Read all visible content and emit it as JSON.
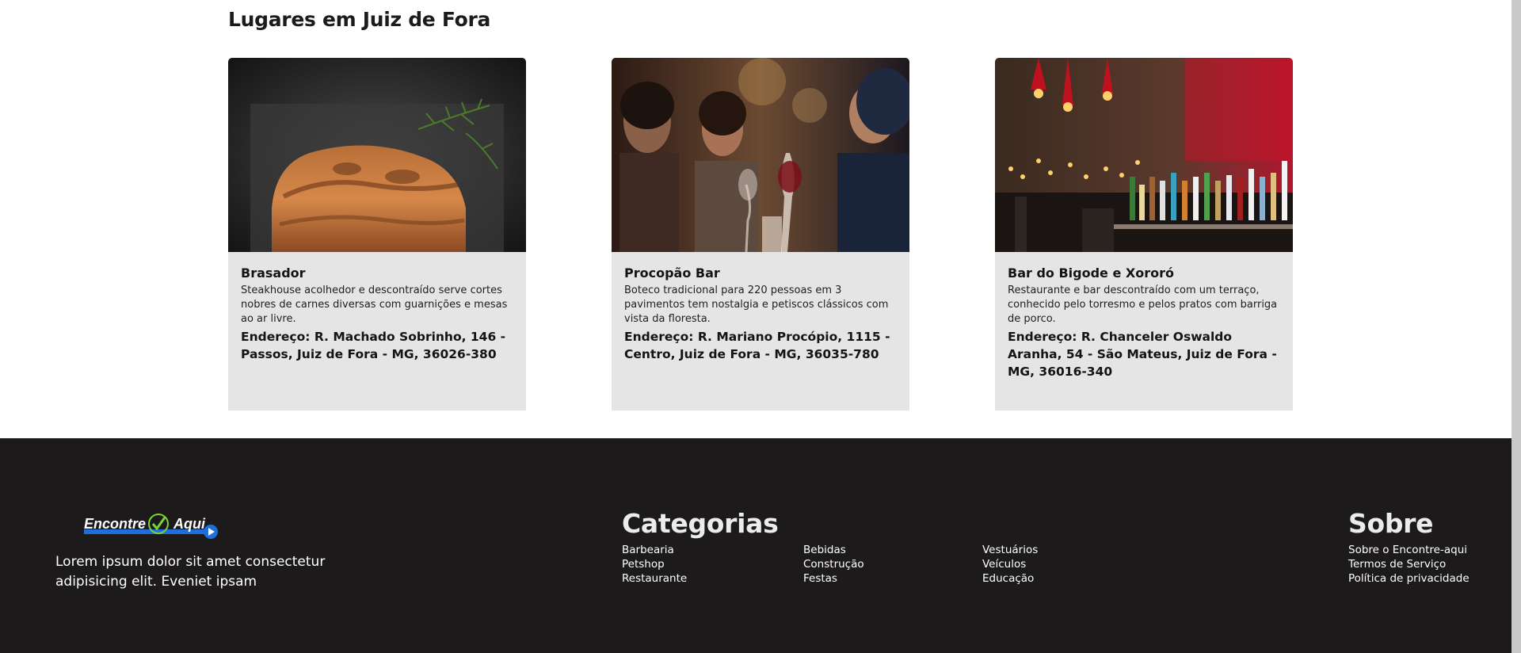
{
  "section": {
    "title": "Lugares em Juiz de Fora"
  },
  "places": [
    {
      "name": "Brasador",
      "description": "Steakhouse acolhedor e descontraído serve cortes nobres de carnes diversas com guarnições e mesas ao ar livre.",
      "address": "Endereço: R. Machado Sobrinho, 146 - Passos, Juiz de Fora - MG, 36026-380"
    },
    {
      "name": "Procopão Bar",
      "description": "Boteco tradicional para 220 pessoas em 3 pavimentos tem nostalgia e petiscos clássicos com vista da floresta.",
      "address": "Endereço: R. Mariano Procópio, 1115 - Centro, Juiz de Fora - MG, 36035-780"
    },
    {
      "name": "Bar do Bigode e Xororó",
      "description": "Restaurante e bar descontraído com um terraço, conhecido pelo torresmo e pelos pratos com barriga de porco.",
      "address": "Endereço: R. Chanceler Oswaldo Aranha, 54 - São Mateus, Juiz de Fora - MG, 36016-340"
    }
  ],
  "footer": {
    "logo": {
      "word1": "Encontre",
      "word2": "Aqui"
    },
    "tagline": "Lorem ipsum dolor sit amet consectetur adipisicing elit. Eveniet ipsam",
    "categories": {
      "title": "Categorias",
      "columns": [
        [
          "Barbearia",
          "Petshop",
          "Restaurante"
        ],
        [
          "Bebidas",
          "Construção",
          "Festas"
        ],
        [
          "Vestuários",
          "Veículos",
          "Educação"
        ]
      ]
    },
    "about": {
      "title": "Sobre",
      "links": [
        "Sobre o Encontre-aqui",
        "Termos de Serviço",
        "Política de privacidade"
      ]
    }
  },
  "colors": {
    "footer_bg": "#1c1a1b",
    "card_bg": "#e5e5e5",
    "logo_blue": "#1e6fd9",
    "logo_green": "#7bd13a"
  }
}
